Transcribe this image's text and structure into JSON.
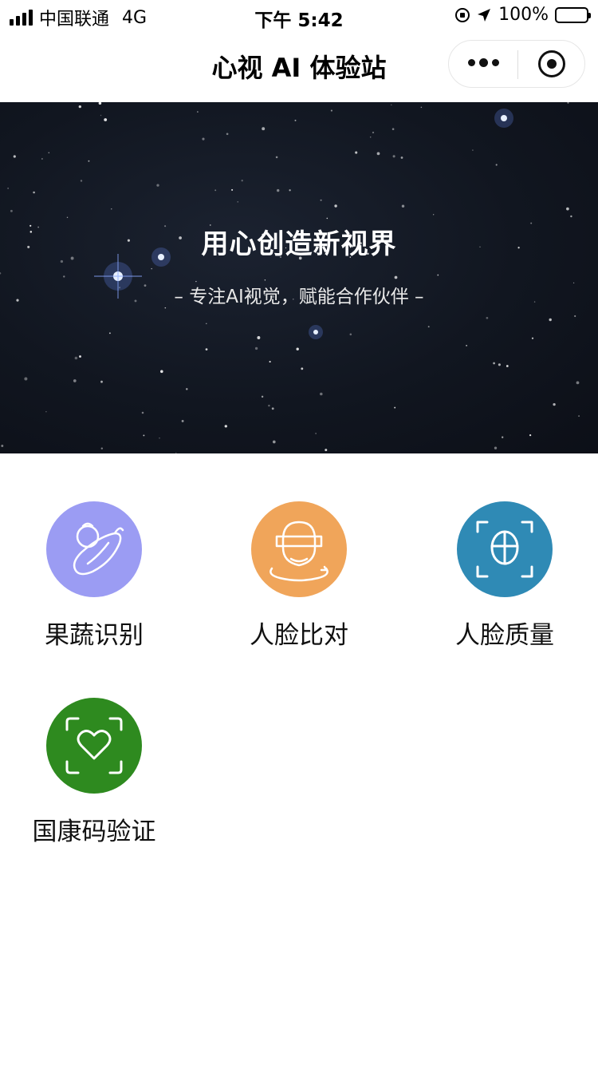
{
  "status_bar": {
    "carrier": "中国联通",
    "network": "4G",
    "time": "下午 5:42",
    "battery": "100%",
    "battery_level": 1.0
  },
  "nav": {
    "title": "心视 AI 体验站",
    "more_icon": "more-dots-icon",
    "close_icon": "target-circle-icon"
  },
  "banner": {
    "title": "用心创造新视界",
    "subtitle": "– 专注AI视觉，赋能合作伙伴 –"
  },
  "features": [
    {
      "label": "果蔬识别",
      "icon": "vegetable-icon",
      "color": "#9b9cf3"
    },
    {
      "label": "人脸比对",
      "icon": "face-compare-icon",
      "color": "#f0a55a"
    },
    {
      "label": "人脸质量",
      "icon": "face-scan-icon",
      "color": "#2f8ab5"
    },
    {
      "label": "国康码验证",
      "icon": "heart-scan-icon",
      "color": "#2e8a1f"
    }
  ]
}
